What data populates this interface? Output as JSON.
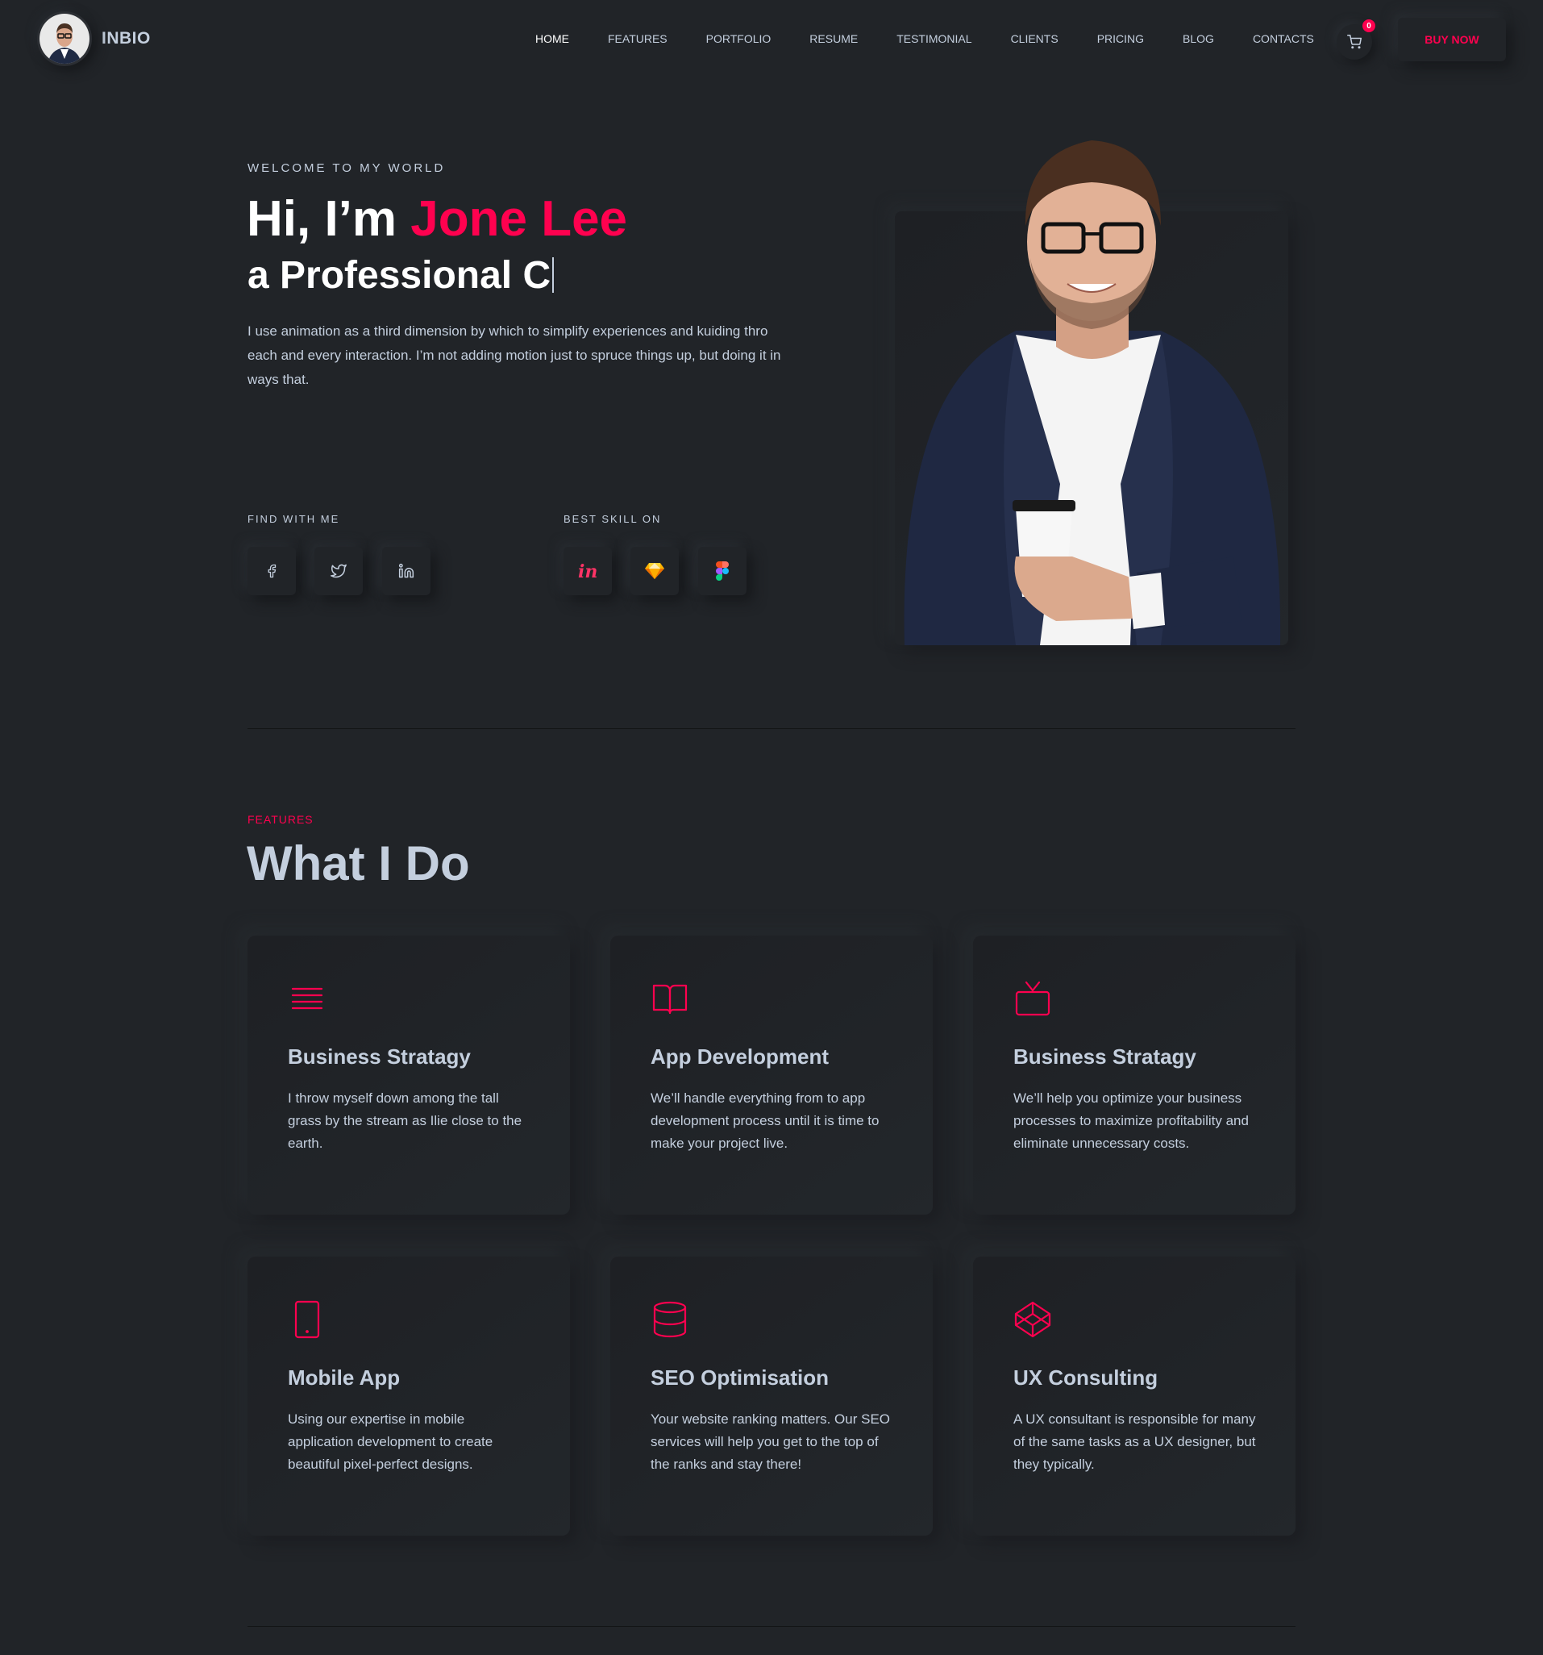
{
  "brand": {
    "name": "INBIO"
  },
  "nav": {
    "items": [
      {
        "label": "HOME",
        "active": true
      },
      {
        "label": "FEATURES"
      },
      {
        "label": "PORTFOLIO"
      },
      {
        "label": "RESUME"
      },
      {
        "label": "TESTIMONIAL"
      },
      {
        "label": "CLIENTS"
      },
      {
        "label": "PRICING"
      },
      {
        "label": "BLOG"
      },
      {
        "label": "CONTACTS"
      }
    ],
    "cart_count": "0",
    "buy_label": "BUY NOW"
  },
  "hero": {
    "eyebrow": "WELCOME TO MY WORLD",
    "title_prefix": "Hi, I’m ",
    "title_name": "Jone Lee",
    "subtitle": "a Professional C",
    "description": "I use animation as a third dimension by which to simplify experiences and kuiding thro each and every interaction. I’m not adding motion just to spruce things up, but doing it in ways that.",
    "find_label": "FIND WITH ME",
    "skill_label": "BEST SKILL ON",
    "social_icons": [
      "facebook-icon",
      "twitter-icon",
      "linkedin-icon"
    ],
    "skill_icons": [
      "invision-icon",
      "sketch-icon",
      "figma-icon"
    ]
  },
  "features": {
    "eyebrow": "FEATURES",
    "title": "What I Do",
    "cards": [
      {
        "icon": "menu-lines-icon",
        "title": "Business Stratagy",
        "desc": "I throw myself down among the tall grass by the stream as Ilie close to the earth."
      },
      {
        "icon": "book-open-icon",
        "title": "App Development",
        "desc": "We’ll handle everything from to app development process until it is time to make your project live."
      },
      {
        "icon": "tv-icon",
        "title": "Business Stratagy",
        "desc": "We’ll help you optimize your business processes to maximize profitability and eliminate unnecessary costs."
      },
      {
        "icon": "tablet-icon",
        "title": "Mobile App",
        "desc": "Using our expertise in mobile application development to create beautiful pixel-perfect designs."
      },
      {
        "icon": "database-icon",
        "title": "SEO Optimisation",
        "desc": "Your website ranking matters. Our SEO services will help you get to the top of the ranks and stay there!"
      },
      {
        "icon": "codepen-icon",
        "title": "UX Consulting",
        "desc": "A UX consultant is responsible for many of the same tasks as a UX designer, but they typically."
      }
    ]
  },
  "colors": {
    "accent": "#ff014f",
    "background": "#212428",
    "text": "#c4cfde"
  }
}
